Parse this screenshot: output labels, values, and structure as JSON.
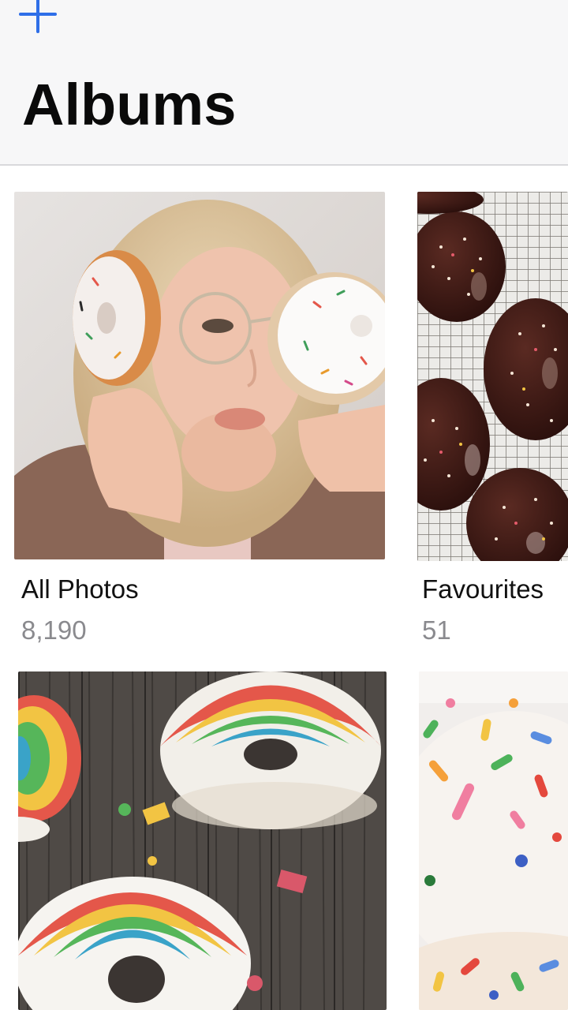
{
  "header": {
    "title": "Albums",
    "add_icon": "plus-icon",
    "accent_color": "#2f6fe8"
  },
  "albums": [
    {
      "name": "All Photos",
      "count": "8,190",
      "thumbnail": "woman-holding-donuts-photo"
    },
    {
      "name": "Favourites",
      "count": "51",
      "thumbnail": "chocolate-sprinkle-donuts-photo"
    },
    {
      "name": "",
      "count": "",
      "thumbnail": "rainbow-donuts-photo"
    },
    {
      "name": "",
      "count": "",
      "thumbnail": "sprinkle-donut-closeup-photo"
    }
  ]
}
